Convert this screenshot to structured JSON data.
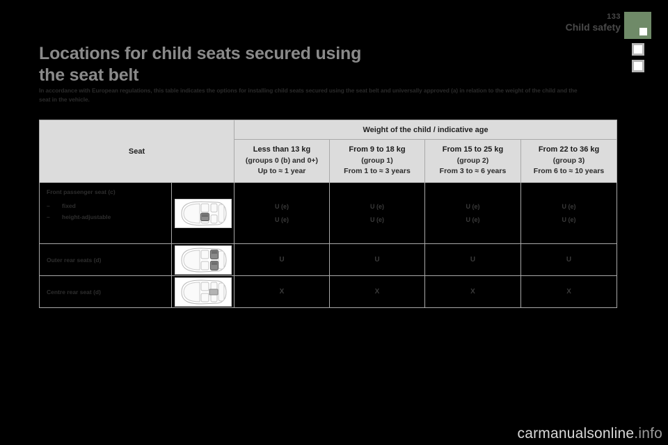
{
  "page": {
    "number": "133",
    "section": "Child safety"
  },
  "title": {
    "line1": "Locations for child seats secured using",
    "line2": "the seat belt"
  },
  "intro": "In accordance with European regulations, this table indicates the options for installing child seats secured using the seat belt and universally approved (a) in relation to the weight of the child and the seat in the vehicle.",
  "table": {
    "seat_header": "Seat",
    "weight_header": "Weight of the child / indicative age",
    "columns": [
      {
        "kg": "Less than 13 kg",
        "group": "(groups 0 (b) and 0+)",
        "age": "Up to ≈ 1 year"
      },
      {
        "kg": "From 9 to 18 kg",
        "group": "(group 1)",
        "age": "From 1 to ≈ 3 years"
      },
      {
        "kg": "From 15 to 25 kg",
        "group": "(group 2)",
        "age": "From 3 to ≈ 6 years"
      },
      {
        "kg": "From 22 to 36 kg",
        "group": "(group 3)",
        "age": "From 6 to ≈ 10 years"
      }
    ],
    "rows": [
      {
        "label": "Front passenger seat (c)",
        "sub_items": [
          "fixed",
          "height-adjustable"
        ],
        "diagram": "car-top-view-front-passenger",
        "values": [
          [
            "U (e)",
            "U (e)"
          ],
          [
            "U (e)",
            "U (e)"
          ],
          [
            "U (e)",
            "U (e)"
          ],
          [
            "U (e)",
            "U (e)"
          ]
        ]
      },
      {
        "label": "Outer rear seats (d)",
        "sub_items": [],
        "diagram": "car-top-view-outer-rear",
        "values": [
          [
            "U"
          ],
          [
            "U"
          ],
          [
            "U"
          ],
          [
            "U"
          ]
        ]
      },
      {
        "label": "Centre rear seat (d)",
        "sub_items": [],
        "diagram": "car-top-view-centre-rear",
        "values": [
          [
            "X"
          ],
          [
            "X"
          ],
          [
            "X"
          ],
          [
            "X"
          ]
        ]
      }
    ]
  },
  "watermark": {
    "strong": "carmanualsonline",
    "dim": ".info"
  },
  "colors": {
    "tab_accent": "#6f8a68",
    "table_header_bg": "#dcdcdc",
    "page_bg": "#000000",
    "title_text": "#8a8a8a"
  }
}
